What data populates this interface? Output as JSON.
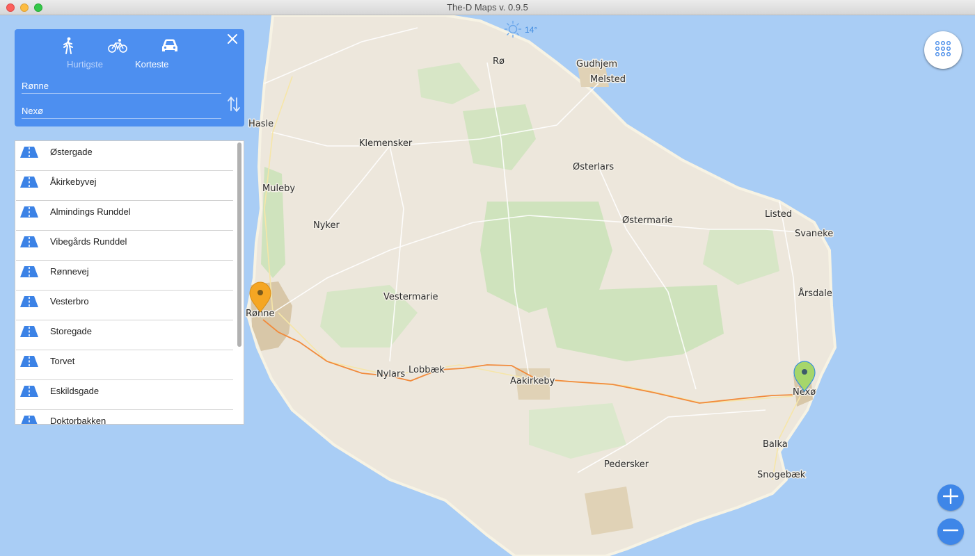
{
  "window": {
    "title": "The-D Maps v. 0.9.5"
  },
  "weather": {
    "temperature": "14°",
    "icon": "sun-icon"
  },
  "route_panel": {
    "modes": [
      "walk-icon",
      "bike-icon",
      "car-icon"
    ],
    "options": {
      "fastest": "Hurtigste",
      "shortest": "Korteste"
    },
    "selected_option": "Korteste",
    "from": "Rønne",
    "to": "Nexø"
  },
  "directions": [
    "Østergade",
    "Åkirkebyvej",
    "Almindings Runddel",
    "Vibegårds Runddel",
    "Rønnevej",
    "Vesterbro",
    "Storegade",
    "Torvet",
    "Eskildsgade",
    "Doktorbakken"
  ],
  "map": {
    "places": [
      "Rø",
      "Gudhjem",
      "Melsted",
      "Hasle",
      "Klemensker",
      "Østerlars",
      "Muleby",
      "Nyker",
      "Østermarie",
      "Listed",
      "Svaneke",
      "Vestermarie",
      "Rønne",
      "Årsdale",
      "Nylars",
      "Lobbæk",
      "Aakirkeby",
      "Nexø",
      "Balka",
      "Pedersker",
      "Snogebæk"
    ],
    "colors": {
      "sea": "#a9cdf5",
      "land": "#ede7dc",
      "forest": "#cfe3bd",
      "route": "#f18a3b",
      "start_pin": "#f5a623",
      "end_pin": "#a6d66a"
    }
  },
  "controls": {
    "grid": "grid-icon",
    "zoom_in": "plus-icon",
    "zoom_out": "minus-icon"
  }
}
